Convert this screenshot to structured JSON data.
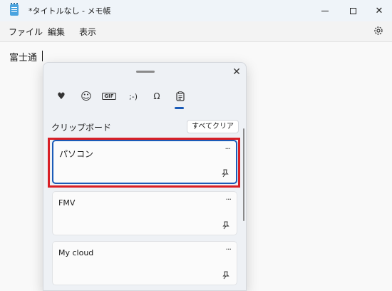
{
  "window": {
    "title": "*タイトルなし - メモ帳",
    "minimize_symbol": "—",
    "maximize_symbol": "□",
    "close_symbol": "✕"
  },
  "menu": {
    "items": [
      "ファイル",
      "編集",
      "表示"
    ]
  },
  "editor": {
    "text": "富士通"
  },
  "clipboard_panel": {
    "close_symbol": "✕",
    "tabs": [
      {
        "icon": "heart-sticker-icon",
        "glyph": "♥"
      },
      {
        "icon": "emoji-icon",
        "glyph": "☺"
      },
      {
        "icon": "gif-icon",
        "glyph": "GIF"
      },
      {
        "icon": "kaomoji-icon",
        "glyph": ";-)"
      },
      {
        "icon": "symbols-icon",
        "glyph": "Ω"
      },
      {
        "icon": "clipboard-icon",
        "glyph": "📋"
      }
    ],
    "selected_tab": "clipboard-icon",
    "section_title": "クリップボード",
    "clear_all_label": "すべてクリア",
    "items": [
      {
        "text": "パソコン",
        "more": "···",
        "selected": true
      },
      {
        "text": "FMV",
        "more": "···",
        "selected": false
      },
      {
        "text": "My cloud",
        "more": "···",
        "selected": false
      }
    ]
  },
  "colors": {
    "accent": "#1a5bb8",
    "highlight_border": "#d81f26"
  }
}
